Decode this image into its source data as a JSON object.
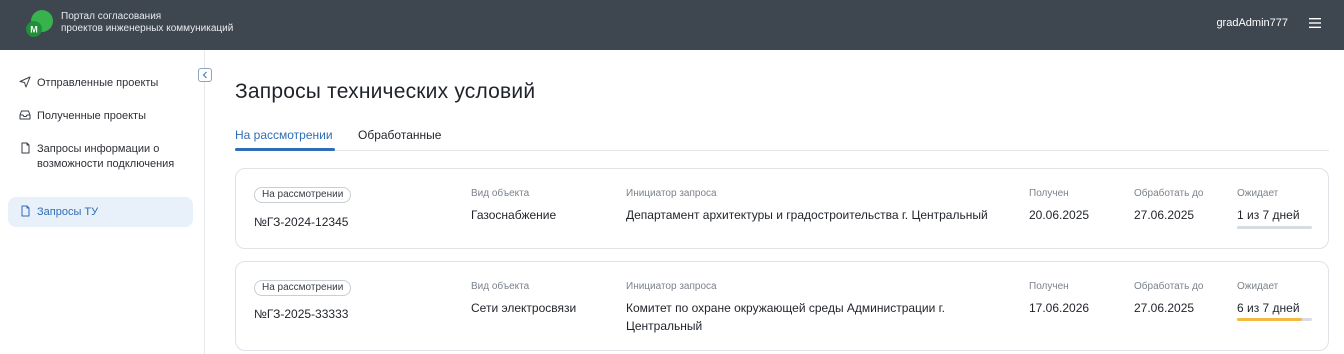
{
  "header": {
    "app_title_line1": "Портал согласования",
    "app_title_line2": "проектов инженерных коммуникаций",
    "logo_letter": "M",
    "user_name": "gradAdmin777",
    "brand_colors": [
      "#37b24d",
      "#1f8f3a"
    ]
  },
  "sidebar": {
    "items": [
      {
        "label": "Отправленные проекты",
        "icon": "send-icon"
      },
      {
        "label": "Полученные проекты",
        "icon": "inbox-icon"
      },
      {
        "label": "Запросы информации о возможности подключения",
        "icon": "document-icon"
      },
      {
        "label": "Запросы ТУ",
        "icon": "document-icon",
        "active": true
      }
    ]
  },
  "main": {
    "page_title": "Запросы технических условий",
    "tabs": [
      {
        "label": "На рассмотрении",
        "active": true
      },
      {
        "label": "Обработанные",
        "active": false
      }
    ],
    "columns": {
      "object_type": "Вид объекта",
      "initiator": "Инициатор запроса",
      "received": "Получен",
      "process_by": "Обработать до",
      "waiting": "Ожидает"
    },
    "requests": [
      {
        "status": "На рассмотрении",
        "number": "№ГЗ-2024-12345",
        "object_type": "Газоснабжение",
        "initiator": "Департамент архитектуры и градостроительства г. Центральный",
        "received": "20.06.2025",
        "process_by": "27.06.2025",
        "waiting": "1 из 7 дней",
        "progress": 0.14,
        "progress_color": "#d7dce2"
      },
      {
        "status": "На рассмотрении",
        "number": "№ГЗ-2025-33333",
        "object_type": "Сети электросвязи",
        "initiator": "Комитет по охране окружающей среды Администрации г. Центральный",
        "received": "17.06.2026",
        "process_by": "27.06.2025",
        "waiting": "6 из 7 дней",
        "progress": 0.86,
        "progress_color": "#f5b942"
      }
    ]
  }
}
